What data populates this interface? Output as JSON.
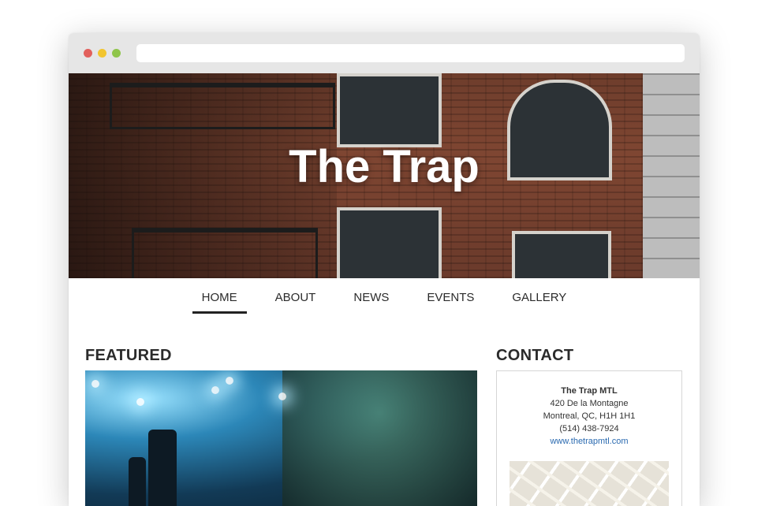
{
  "site": {
    "title": "The Trap"
  },
  "nav": {
    "items": [
      "HOME",
      "ABOUT",
      "NEWS",
      "EVENTS",
      "GALLERY"
    ],
    "active": "HOME"
  },
  "featured": {
    "heading": "FEATURED"
  },
  "contact": {
    "heading": "CONTACT",
    "name": "The Trap MTL",
    "address_line1": "420 De la Montagne",
    "address_line2": "Montreal, QC, H1H 1H1",
    "phone": "(514) 438-7924",
    "website": "www.thetrapmtl.com"
  },
  "colors": {
    "window_chrome": "#e6e6e6",
    "close": "#e2605c",
    "minimize": "#f2c52f",
    "maximize": "#8fc54a",
    "link": "#2a6ab0"
  }
}
